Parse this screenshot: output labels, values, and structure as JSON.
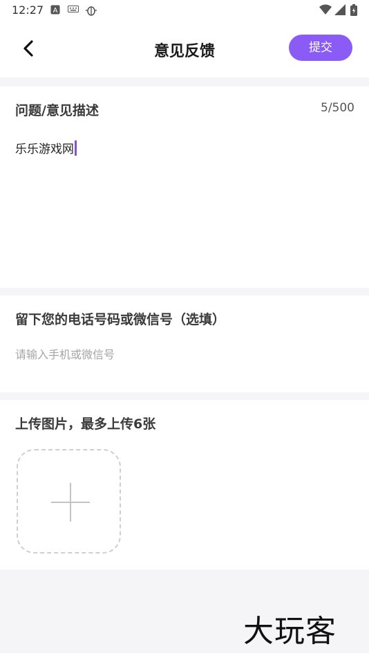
{
  "status_bar": {
    "time": "12:27",
    "icons": [
      "a-icon",
      "keyboard-icon",
      "bug-icon",
      "wifi-icon",
      "signal-icon",
      "battery-icon"
    ]
  },
  "header": {
    "title": "意见反馈",
    "submit_label": "提交",
    "back_icon": "chevron-left-icon"
  },
  "description": {
    "label": "问题/意见描述",
    "counter": "5/500",
    "value": "乐乐游戏网"
  },
  "contact": {
    "label": "留下您的电话号码或微信号（选填）",
    "placeholder": "请输入手机或微信号"
  },
  "upload": {
    "label": "上传图片，最多上传6张",
    "add_icon": "plus-icon"
  },
  "watermark": "大玩客",
  "colors": {
    "accent": "#8a5cf5",
    "background": "#f5f5f7",
    "placeholder": "#a5a5a5"
  }
}
